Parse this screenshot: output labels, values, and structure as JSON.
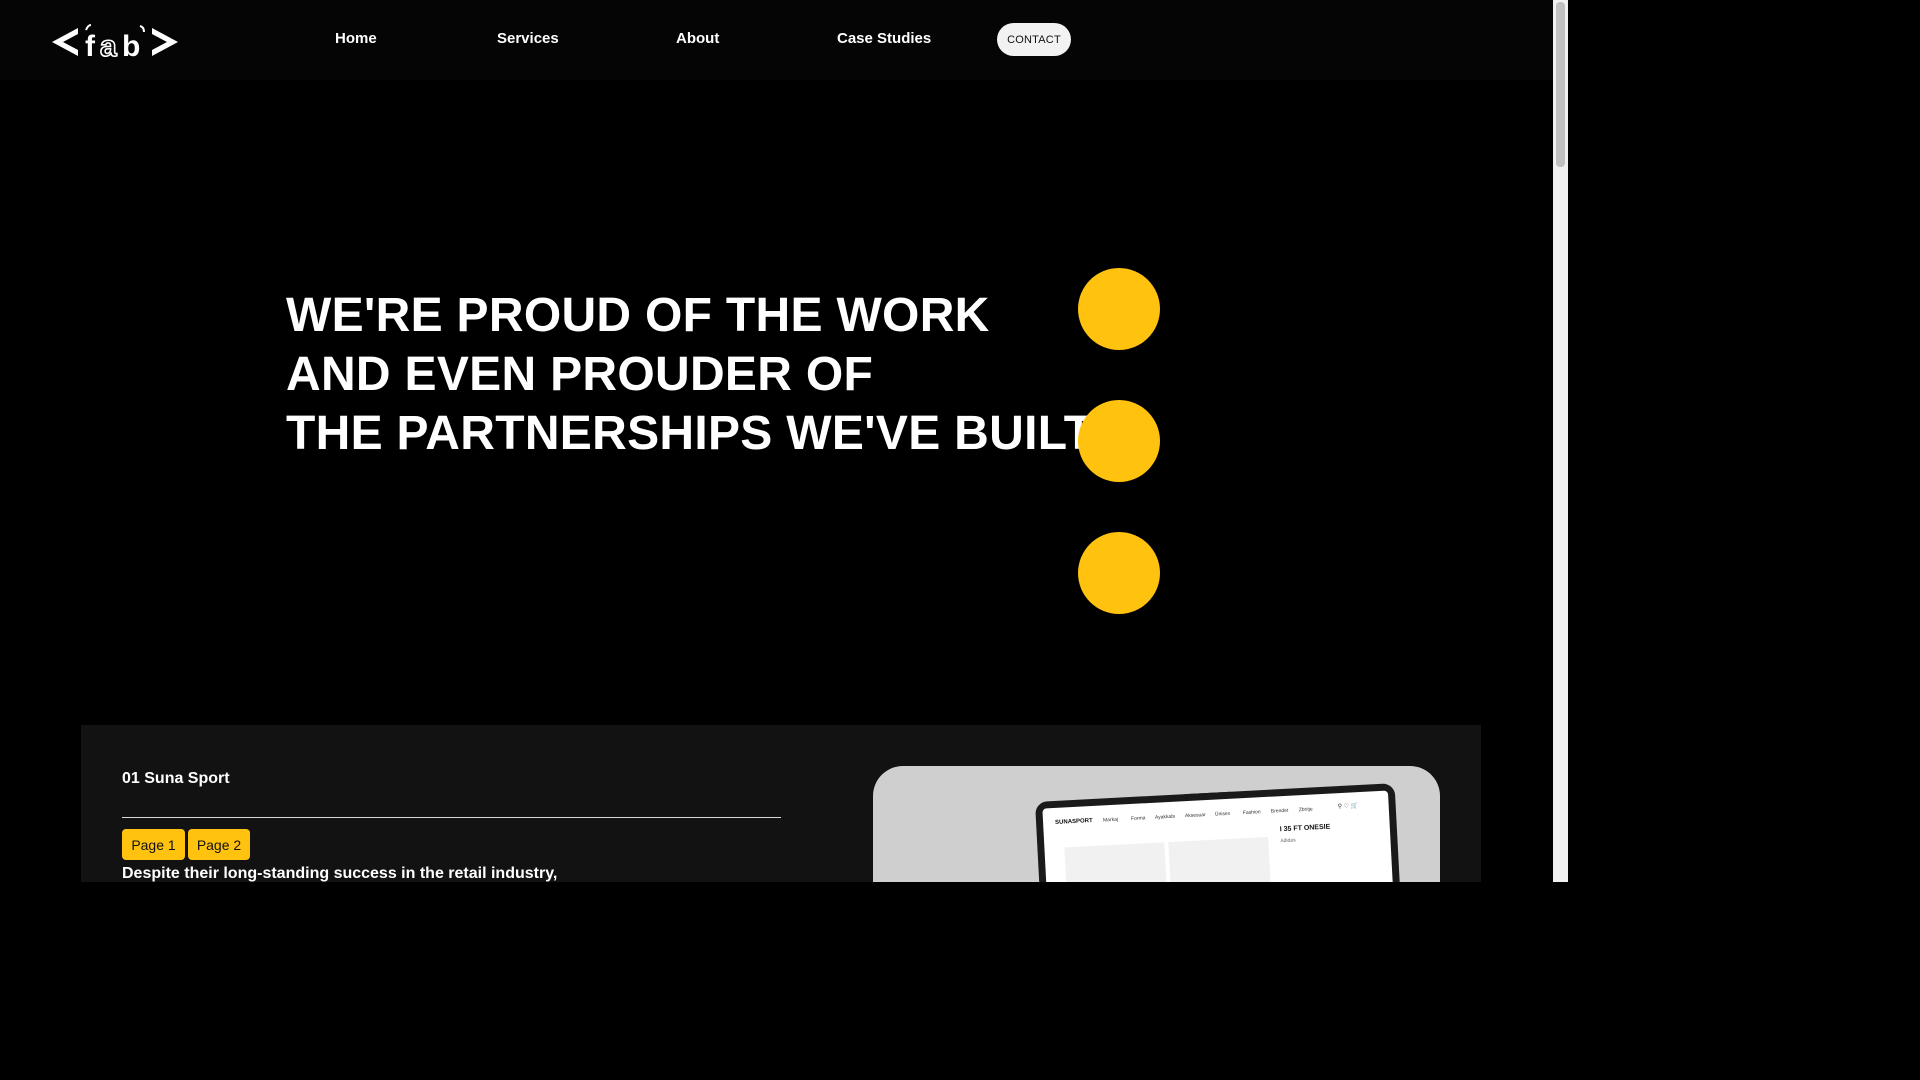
{
  "header": {
    "logo_alt": "<fab>",
    "nav": {
      "home": "Home",
      "services": "Services",
      "about": "About",
      "case_studies": "Case Studies"
    },
    "contact_label": "CONTACT"
  },
  "hero": {
    "lines": [
      "WE'RE PROUD OF THE WORK",
      "AND EVEN PROUDER OF",
      "THE PARTNERSHIPS WE'VE BUILT."
    ]
  },
  "case": {
    "title": "01 Suna Sport",
    "page_buttons": [
      "Page 1",
      "Page 2"
    ],
    "description": "Despite their long-standing success in the retail industry,",
    "preview": {
      "brand": "SUNASPORT",
      "nav_items": [
        "Markaj",
        "Forma",
        "Ayakkabı",
        "Aksesuar",
        "Ünisex",
        "Fashion",
        "Brendet",
        "Zbritje"
      ],
      "product_title": "I 35 FT ONESIE",
      "product_sub": "Adidas"
    }
  },
  "colors": {
    "accent": "#ffc20e",
    "background": "#000000",
    "section_bg": "#121212"
  }
}
